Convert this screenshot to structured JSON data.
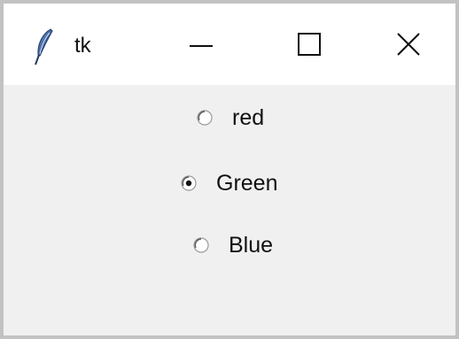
{
  "window": {
    "title": "tk",
    "icon": "tk-feather-icon",
    "controls": {
      "minimize": "minimize-icon",
      "maximize": "maximize-icon",
      "close": "close-icon"
    }
  },
  "radios": [
    {
      "label": "red",
      "checked": false
    },
    {
      "label": "Green",
      "checked": true
    },
    {
      "label": "Blue",
      "checked": false
    }
  ],
  "colors": {
    "titlebar": "#ffffff",
    "client": "#f0f0f0",
    "border": "#c2c2c2",
    "text": "#111111"
  }
}
